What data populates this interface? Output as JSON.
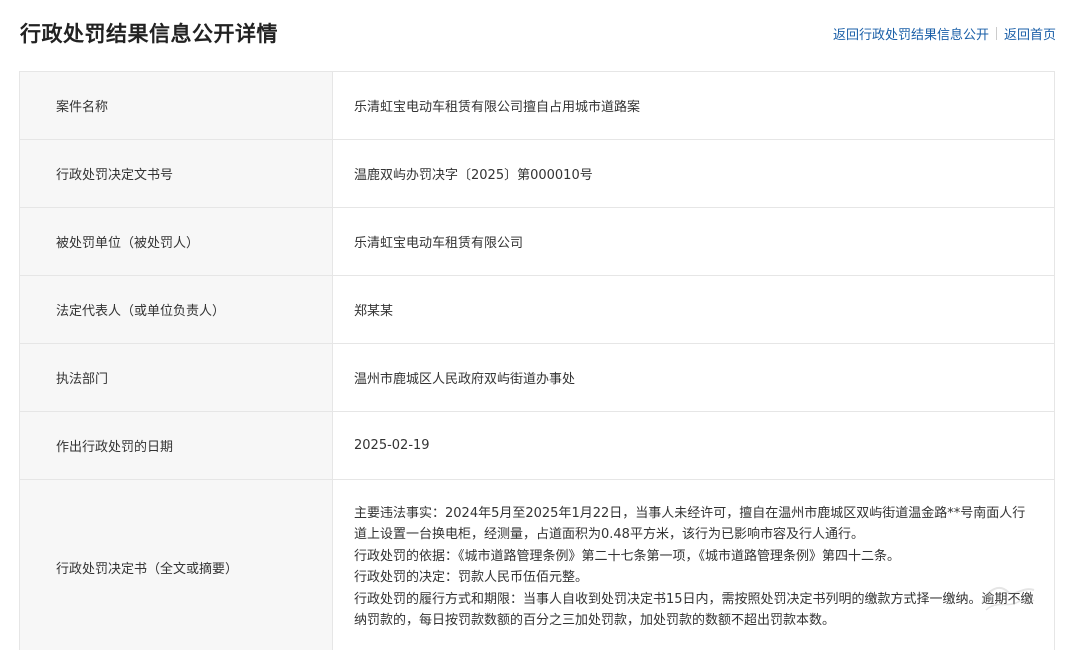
{
  "header": {
    "title": "行政处罚结果信息公开详情",
    "link_back_list": "返回行政处罚结果信息公开",
    "link_home": "返回首页"
  },
  "rows": [
    {
      "label": "案件名称",
      "value": "乐清虹宝电动车租赁有限公司擅自占用城市道路案"
    },
    {
      "label": "行政处罚决定文书号",
      "value": "温鹿双屿办罚决字〔2025〕第000010号"
    },
    {
      "label": "被处罚单位（被处罚人）",
      "value": "乐清虹宝电动车租赁有限公司"
    },
    {
      "label": "法定代表人（或单位负责人）",
      "value": "郑某某"
    },
    {
      "label": "执法部门",
      "value": "温州市鹿城区人民政府双屿街道办事处"
    },
    {
      "label": "作出行政处罚的日期",
      "value": "2025-02-19"
    }
  ],
  "decision": {
    "label": "行政处罚决定书（全文或摘要）",
    "lines": [
      "主要违法事实：2024年5月至2025年1月22日，当事人未经许可，擅自在温州市鹿城区双屿街道温金路**号南面人行道上设置一台换电柜，经测量，占道面积为0.48平方米，该行为已影响市容及行人通行。",
      "行政处罚的依据：《城市道路管理条例》第二十七条第一项，《城市道路管理条例》第四十二条。",
      "行政处罚的决定：罚款人民币伍佰元整。",
      "行政处罚的履行方式和期限：当事人自收到处罚决定书15日内，需按照处罚决定书列明的缴款方式择一缴纳。逾期不缴纳罚款的，每日按罚款数额的百分之三加处罚款，加处罚款的数额不超出罚款本数。"
    ]
  }
}
